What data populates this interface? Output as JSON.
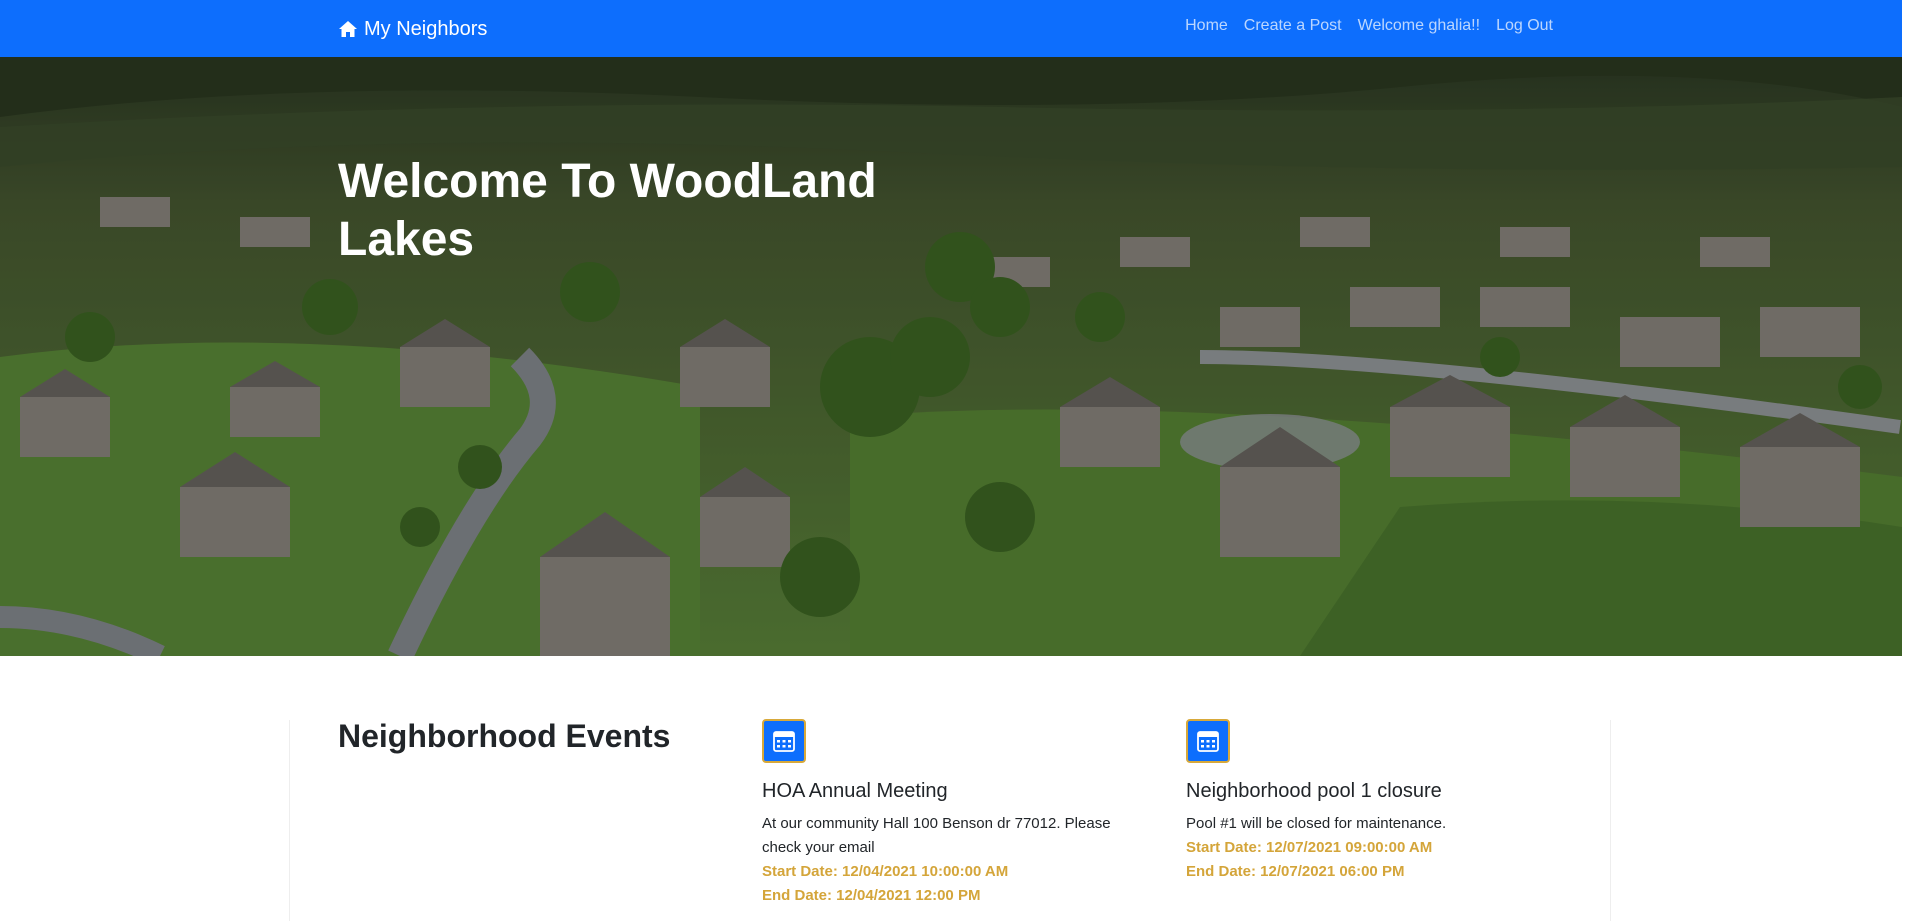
{
  "navbar": {
    "brand": "My Neighbors",
    "brand_icon": "house-icon",
    "links": [
      "Home",
      "Create a Post",
      "Welcome ghalia!!",
      "Log Out"
    ]
  },
  "hero": {
    "title": "Welcome To WoodLand Lakes"
  },
  "events": {
    "heading": "Neighborhood Events",
    "items": [
      {
        "icon": "calendar-icon",
        "title": "HOA Annual Meeting",
        "description": "At our community Hall 100 Benson dr 77012. Please check your email",
        "start": "Start Date: 12/04/2021 10:00:00 AM",
        "end": "End Date: 12/04/2021 12:00 PM"
      },
      {
        "icon": "calendar-icon",
        "title": "Neighborhood pool 1 closure",
        "description": "Pool #1 will be closed for maintenance.",
        "start": "Start Date: 12/07/2021 09:00:00 AM",
        "end": "End Date: 12/07/2021 06:00 PM"
      }
    ]
  },
  "colors": {
    "primary": "#0d6efd",
    "date_accent": "#d4a53a"
  }
}
